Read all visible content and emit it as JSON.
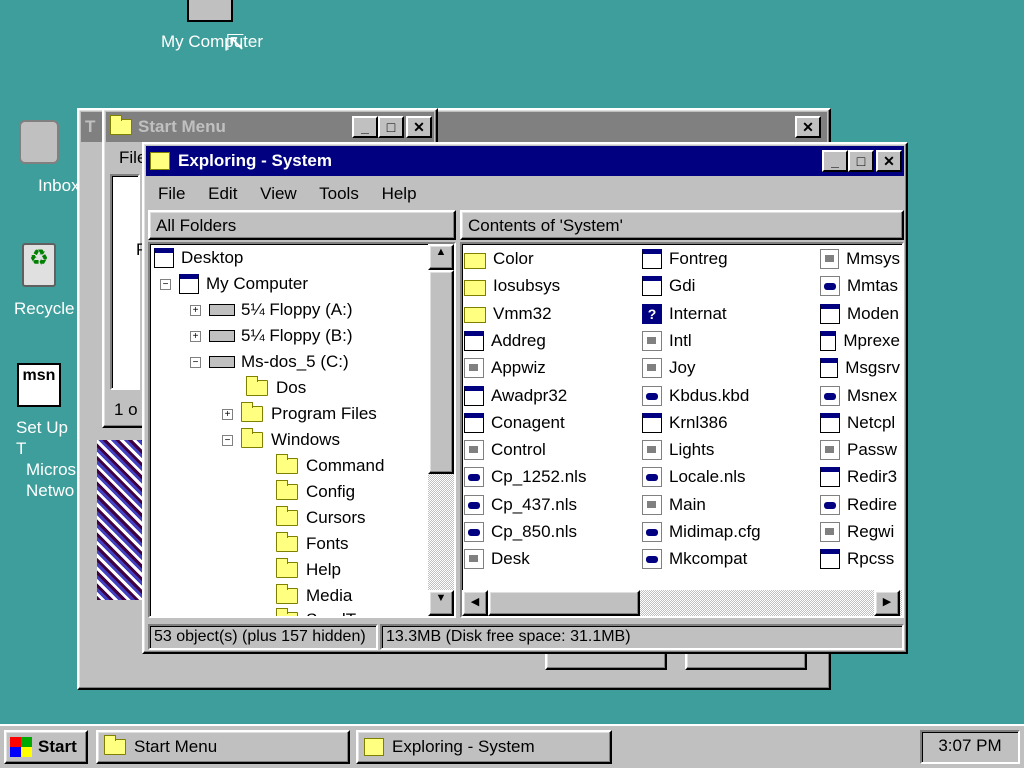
{
  "desktop": {
    "icons": [
      {
        "label": "My Computer"
      },
      {
        "label": "Inbox"
      },
      {
        "label": "Recycle"
      },
      {
        "label_lines": [
          "Set Up T",
          "Micros",
          "Netwo"
        ]
      }
    ]
  },
  "bg_window": {
    "title": "T"
  },
  "start_menu_window": {
    "title": "Start Menu",
    "menu_file": "File",
    "status": "1 o",
    "side_letter": "P"
  },
  "explorer": {
    "title": "Exploring - System",
    "menu": [
      "File",
      "Edit",
      "View",
      "Tools",
      "Help"
    ],
    "all_folders_label": "All Folders",
    "contents_label": "Contents of 'System'",
    "tree": [
      {
        "label": "Desktop"
      },
      {
        "label": "My Computer"
      },
      {
        "label": "5¼ Floppy (A:)"
      },
      {
        "label": "5¼ Floppy (B:)"
      },
      {
        "label": "Ms-dos_5 (C:)"
      },
      {
        "label": "Dos"
      },
      {
        "label": "Program Files"
      },
      {
        "label": "Windows"
      },
      {
        "label": "Command"
      },
      {
        "label": "Config"
      },
      {
        "label": "Cursors"
      },
      {
        "label": "Fonts"
      },
      {
        "label": "Help"
      },
      {
        "label": "Media"
      },
      {
        "label": "SendTo"
      }
    ],
    "files_col1": [
      "Color",
      "Iosubsys",
      "Vmm32",
      "Addreg",
      "Appwiz",
      "Awadpr32",
      "Conagent",
      "Control",
      "Cp_1252.nls",
      "Cp_437.nls",
      "Cp_850.nls",
      "Desk"
    ],
    "files_col2": [
      "Fontreg",
      "Gdi",
      "Internat",
      "Intl",
      "Joy",
      "Kbdus.kbd",
      "Krnl386",
      "Lights",
      "Locale.nls",
      "Main",
      "Midimap.cfg",
      "Mkcompat"
    ],
    "files_col3": [
      "Mmsys",
      "Mmtas",
      "Moden",
      "Mprexe",
      "Msgsrv",
      "Msnex",
      "Netcpl",
      "Passw",
      "Redir3",
      "Redire",
      "Regwi",
      "Rpcss"
    ],
    "status_objects": "53 object(s) (plus 157 hidden)",
    "status_size": "13.3MB (Disk free space: 31.1MB)"
  },
  "taskbar": {
    "start": "Start",
    "tasks": [
      "Start Menu",
      "Exploring - System"
    ],
    "clock": "3:07 PM"
  },
  "colors": {
    "desktop": "#3e9e9b",
    "title_active": "#000080",
    "title_inactive": "#808080",
    "face": "#c0c0c0"
  }
}
